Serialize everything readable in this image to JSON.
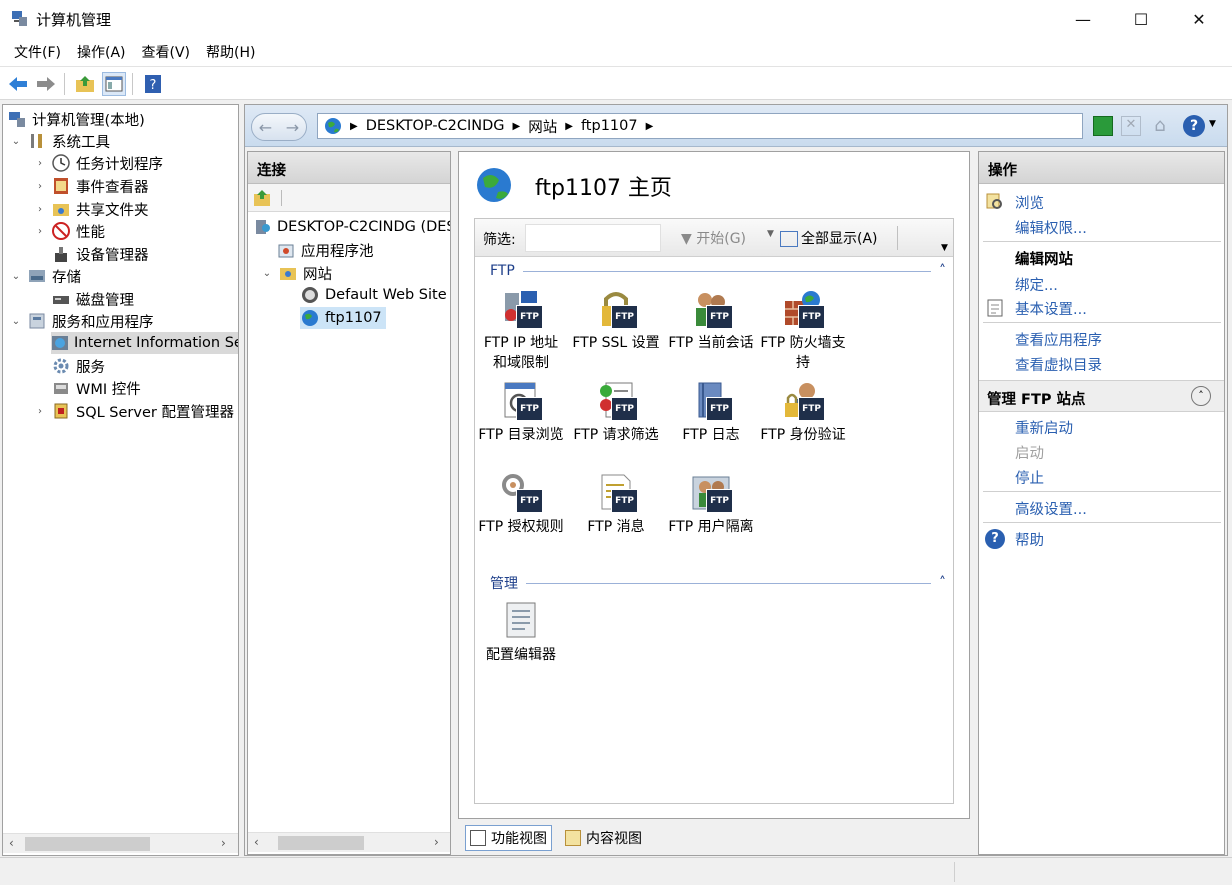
{
  "window": {
    "title": "计算机管理",
    "minimize": "—",
    "maximize": "☐",
    "close": "✕"
  },
  "menu": [
    "文件(F)",
    "操作(A)",
    "查看(V)",
    "帮助(H)"
  ],
  "tree": {
    "root": "计算机管理(本地)",
    "system_tools": "系统工具",
    "task_scheduler": "任务计划程序",
    "event_viewer": "事件查看器",
    "shared_folders": "共享文件夹",
    "performance": "性能",
    "device_manager": "设备管理器",
    "storage": "存储",
    "disk_management": "磁盘管理",
    "services_apps": "服务和应用程序",
    "iis": "Internet Information Se",
    "services": "服务",
    "wmi": "WMI 控件",
    "sql": "SQL Server 配置管理器"
  },
  "address": {
    "crumbs": [
      "DESKTOP-C2CINDG",
      "网站",
      "ftp1107"
    ]
  },
  "connections": {
    "title": "连接",
    "server": "DESKTOP-C2CINDG (DES",
    "app_pools": "应用程序池",
    "sites": "网站",
    "default_site": "Default Web Site",
    "ftp_site": "ftp1107"
  },
  "center": {
    "title": "ftp1107 主页",
    "filter_label": "筛选:",
    "start_label": "开始(G)",
    "show_all_label": "全部显示(A)",
    "group_ftp": "FTP",
    "group_manage": "管理",
    "features": [
      {
        "line1": "FTP IP 地址",
        "line2": "和域限制"
      },
      {
        "line1": "FTP SSL 设置",
        "line2": ""
      },
      {
        "line1": "FTP 当前会话",
        "line2": ""
      },
      {
        "line1": "FTP 防火墙支",
        "line2": "持"
      },
      {
        "line1": "FTP 目录浏览",
        "line2": ""
      },
      {
        "line1": "FTP 请求筛选",
        "line2": ""
      },
      {
        "line1": "FTP 日志",
        "line2": ""
      },
      {
        "line1": "FTP 身份验证",
        "line2": ""
      },
      {
        "line1": "FTP 授权规则",
        "line2": ""
      },
      {
        "line1": "FTP 消息",
        "line2": ""
      },
      {
        "line1": "FTP 用户隔离",
        "line2": ""
      }
    ],
    "config_editor": "配置编辑器",
    "badge": "FTP",
    "tab_features": "功能视图",
    "tab_content": "内容视图"
  },
  "actions": {
    "title": "操作",
    "browse": "浏览",
    "edit_perms": "编辑权限...",
    "edit_site": "编辑网站",
    "bindings": "绑定...",
    "basic_settings": "基本设置...",
    "view_apps": "查看应用程序",
    "view_vdirs": "查看虚拟目录",
    "manage_ftp": "管理 FTP 站点",
    "restart": "重新启动",
    "start": "启动",
    "stop": "停止",
    "advanced": "高级设置...",
    "help": "帮助"
  }
}
